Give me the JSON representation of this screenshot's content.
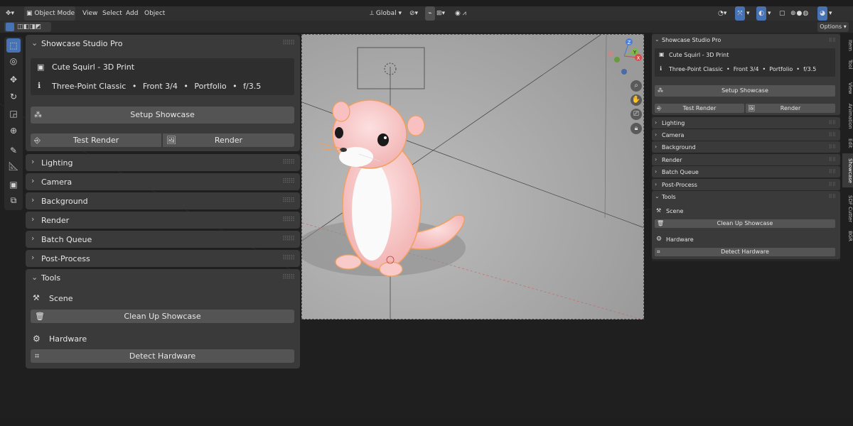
{
  "header": {
    "mode": "Object Mode",
    "menus": [
      "View",
      "Select",
      "Add",
      "Object"
    ],
    "transform_orientation": "Global",
    "options_label": "Options"
  },
  "left_panel": {
    "title": "Showcase Studio Pro",
    "model_name": "Cute Squirl - 3D Print",
    "summary_parts": [
      "Three-Point Classic",
      "Front 3/4",
      "Portfolio",
      "f/3.5"
    ],
    "separator": "•",
    "setup_button": "Setup Showcase",
    "test_render_button": "Test Render",
    "render_button": "Render",
    "sections": [
      "Lighting",
      "Camera",
      "Background",
      "Render",
      "Batch Queue",
      "Post-Process"
    ],
    "tools": {
      "title": "Tools",
      "scene_label": "Scene",
      "clean_button": "Clean Up Showcase",
      "hardware_label": "Hardware",
      "detect_button": "Detect Hardware"
    }
  },
  "right_panel": {
    "title": "Showcase Studio Pro",
    "model_name": "Cute Squirl - 3D Print",
    "summary": "Three-Point Classic  •  Front 3/4  •  Portfolio  •  f/3.5",
    "setup_button": "Setup Showcase",
    "test_render_button": "Test Render",
    "render_button": "Render",
    "sections": [
      "Lighting",
      "Camera",
      "Background",
      "Render",
      "Batch Queue",
      "Post-Process"
    ],
    "tools": {
      "title": "Tools",
      "scene_label": "Scene",
      "clean_button": "Clean Up Showcase",
      "hardware_label": "Hardware",
      "detect_button": "Detect Hardware"
    }
  },
  "side_tabs": [
    "Item",
    "Tool",
    "View",
    "Animation",
    "Edit",
    "Showcase",
    "SDF Cutter",
    "BGR"
  ],
  "gizmo": {
    "x": "X",
    "y": "Y",
    "z": "Z"
  },
  "colors": {
    "accent": "#4772b3",
    "selection_outline": "#f0a060",
    "panel": "#3a3a3a",
    "button": "#545454"
  }
}
